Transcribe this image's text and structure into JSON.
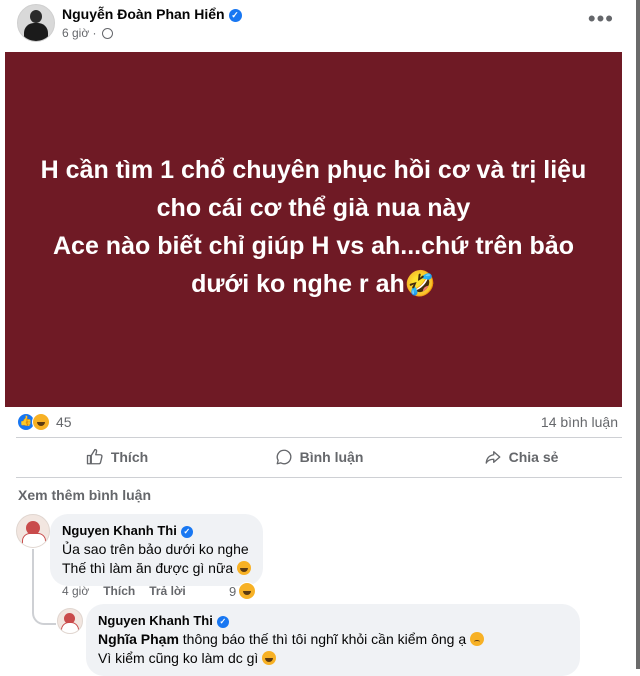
{
  "header": {
    "name": "Nguyễn Đoàn Phan Hiển",
    "time": "6 giờ",
    "more_icon": "more-horizontal-icon"
  },
  "post": {
    "background_color": "#6f1a25",
    "text": "H cần tìm 1 chổ chuyên phục hồi cơ và trị liệu cho cái cơ thể già nua này\nAce nào biết chỉ giúp H vs ah...chứ trên bảo dưới ko nghe r ah🤣"
  },
  "stats": {
    "reaction_count": "45",
    "comment_count": "14 bình luận"
  },
  "actions": {
    "like": "Thích",
    "comment": "Bình luận",
    "share": "Chia sẻ"
  },
  "comments": {
    "see_more": "Xem thêm bình luận",
    "first": {
      "name": "Nguyen Khanh Thi",
      "line1": "Ủa sao trên bảo dưới ko nghe",
      "line2": "Thế thì làm ăn được gì nữa",
      "time": "4 giờ",
      "like": "Thích",
      "reply": "Trả lời",
      "reaction_count": "9"
    },
    "reply": {
      "name": "Nguyen Khanh Thi",
      "mention": "Nghĩa Phạm",
      "line1_rest": " thông báo thế thì tôi nghĩ khỏi cần kiểm ông ạ",
      "line2": "Vì kiểm cũng ko làm dc gì"
    }
  }
}
